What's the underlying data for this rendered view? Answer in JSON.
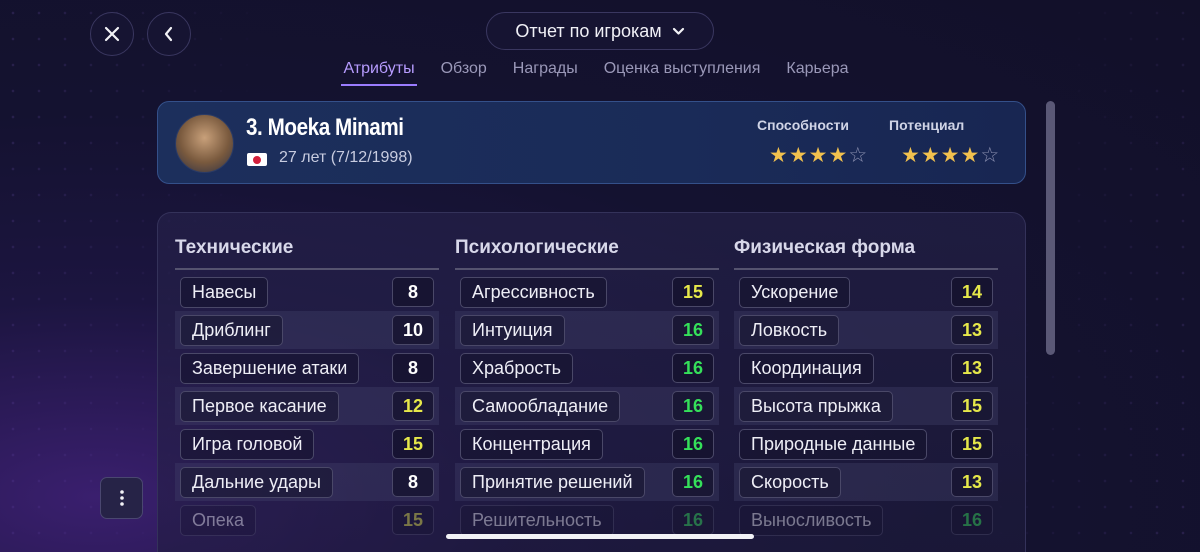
{
  "header": {
    "report_title": "Отчет по игрокам",
    "tabs": [
      "Атрибуты",
      "Обзор",
      "Награды",
      "Оценка выступления",
      "Карьера"
    ],
    "active_tab": 0
  },
  "player": {
    "name": "3. Moeka Minami",
    "nationality_flag": "japan",
    "age_text": "27 лет (7/12/1998)",
    "ability_label": "Способности",
    "potential_label": "Потенциал",
    "ability_stars": 4,
    "potential_stars": 4,
    "max_stars": 5
  },
  "value_colors": {
    "white": "#ffffff",
    "yellow": "#e6e84a",
    "green": "#35e05a"
  },
  "columns": [
    {
      "title": "Технические",
      "attributes": [
        {
          "name": "Навесы",
          "value": "8",
          "color": "white"
        },
        {
          "name": "Дриблинг",
          "value": "10",
          "color": "white"
        },
        {
          "name": "Завершение атаки",
          "value": "8",
          "color": "white"
        },
        {
          "name": "Первое касание",
          "value": "12",
          "color": "yellow"
        },
        {
          "name": "Игра головой",
          "value": "15",
          "color": "yellow"
        },
        {
          "name": "Дальние удары",
          "value": "8",
          "color": "white"
        },
        {
          "name": "Опека",
          "value": "15",
          "color": "yellow"
        }
      ]
    },
    {
      "title": "Психологические",
      "attributes": [
        {
          "name": "Агрессивность",
          "value": "15",
          "color": "yellow"
        },
        {
          "name": "Интуиция",
          "value": "16",
          "color": "green"
        },
        {
          "name": "Храбрость",
          "value": "16",
          "color": "green"
        },
        {
          "name": "Самообладание",
          "value": "16",
          "color": "green"
        },
        {
          "name": "Концентрация",
          "value": "16",
          "color": "green"
        },
        {
          "name": "Принятие решений",
          "value": "16",
          "color": "green"
        },
        {
          "name": "Решительность",
          "value": "16",
          "color": "green"
        }
      ]
    },
    {
      "title": "Физическая форма",
      "attributes": [
        {
          "name": "Ускорение",
          "value": "14",
          "color": "yellow"
        },
        {
          "name": "Ловкость",
          "value": "13",
          "color": "yellow"
        },
        {
          "name": "Координация",
          "value": "13",
          "color": "yellow"
        },
        {
          "name": "Высота прыжка",
          "value": "15",
          "color": "yellow"
        },
        {
          "name": "Природные данные",
          "value": "15",
          "color": "yellow"
        },
        {
          "name": "Скорость",
          "value": "13",
          "color": "yellow"
        },
        {
          "name": "Выносливость",
          "value": "16",
          "color": "green"
        }
      ]
    }
  ],
  "icons": {
    "close": "close-icon",
    "back": "chevron-left-icon",
    "dropdown": "chevron-down-icon",
    "menu": "more-vertical-icon"
  }
}
